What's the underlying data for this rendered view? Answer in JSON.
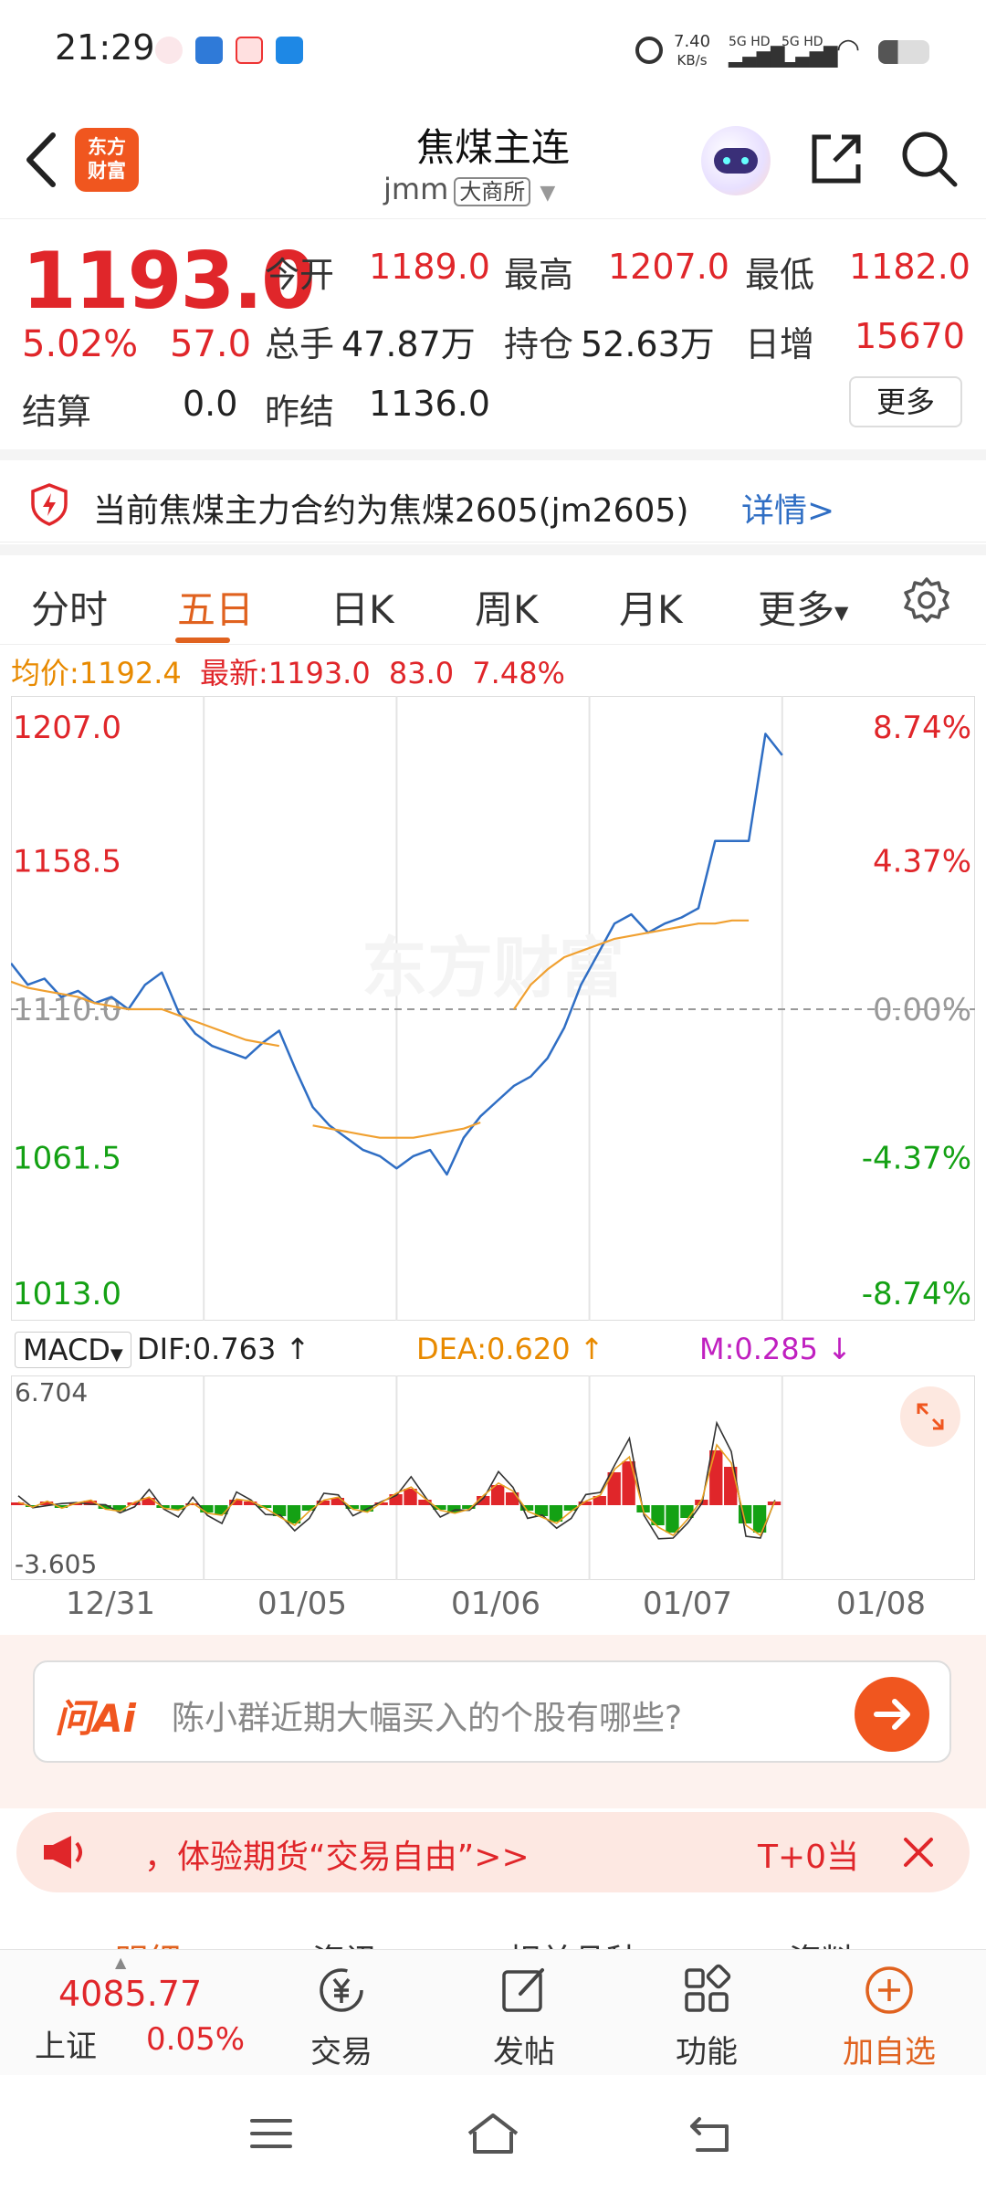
{
  "status_bar": {
    "time": "21:29",
    "net_speed_value": "7.40",
    "net_speed_unit": "KB/s",
    "sig1": "5G HD",
    "sig2": "5G HD"
  },
  "header": {
    "logo_text_line1": "东方",
    "logo_text_line2": "财富",
    "title": "焦煤主连",
    "code": "jmm",
    "exchange": "大商所"
  },
  "quote": {
    "price": "1193.0",
    "change_pct": "5.02%",
    "change_abs": "57.0",
    "open_label": "今开",
    "open": "1189.0",
    "high_label": "最高",
    "high": "1207.0",
    "low_label": "最低",
    "low": "1182.0",
    "volume_label": "总手",
    "volume": "47.87万",
    "oi_label": "持仓",
    "oi": "52.63万",
    "daily_inc_label": "日增",
    "daily_inc": "15670",
    "settle_label": "结算",
    "settle": "0.0",
    "prev_settle_label": "昨结",
    "prev_settle": "1136.0",
    "more": "更多"
  },
  "notice": {
    "text": "当前焦煤主力合约为焦煤2605(jm2605)",
    "detail": "详情>"
  },
  "tabs": [
    "分时",
    "五日",
    "日K",
    "周K",
    "月K",
    "更多"
  ],
  "active_tab": 1,
  "info_line": {
    "avg_label": "均价:",
    "avg": "1192.4",
    "latest_label": "最新:",
    "latest": "1193.0",
    "chg": "83.0",
    "pct": "7.48%"
  },
  "chart_data": {
    "type": "line",
    "title": "",
    "y_ticks_left": [
      "1207.0",
      "1158.5",
      "1110.0",
      "1061.5",
      "1013.0"
    ],
    "y_ticks_right": [
      "8.74%",
      "4.37%",
      "0.00%",
      "-4.37%",
      "-8.74%"
    ],
    "ylim": [
      1013.0,
      1207.0
    ],
    "x_labels": [
      "12/31",
      "01/05",
      "01/06",
      "01/07",
      "01/08"
    ],
    "series": [
      {
        "values": [
          1125,
          1118,
          1120,
          1114,
          1116,
          1112,
          1114,
          1110,
          1118,
          1122,
          1109,
          1102,
          1098,
          1096,
          1094,
          1099,
          1103,
          1090,
          1078,
          1072,
          1068,
          1064,
          1062,
          1058,
          1062,
          1064,
          1056,
          1068,
          1075,
          1080,
          1085,
          1088,
          1094,
          1104,
          1118,
          1128,
          1138,
          1141,
          1135,
          1138,
          1140,
          1143,
          1165,
          1165,
          1165,
          1200,
          1193
        ],
        "color": "#2f6ec4"
      },
      {
        "values": [
          1119,
          1117,
          1116,
          1115,
          1114,
          1112,
          1111,
          1110,
          1110,
          1110,
          1108,
          1106,
          1104,
          1102,
          1100,
          1099,
          1098,
          null,
          1072,
          1071,
          1070,
          1069,
          1068,
          1068,
          1068,
          1069,
          1070,
          1071,
          1073,
          null,
          1110,
          1118,
          1123,
          1127,
          1129,
          1131,
          1133,
          1134,
          1135,
          1136,
          1137,
          1138,
          1138,
          1139,
          1139,
          null,
          null
        ],
        "color": "#f0a030"
      }
    ]
  },
  "macd": {
    "selector": "MACD",
    "dif": "DIF:0.763",
    "dea": "DEA:0.620",
    "m": "M:0.285",
    "y_top": "6.704",
    "y_bottom": "-3.605"
  },
  "ai": {
    "logo": "问Ai",
    "placeholder": "陈小群近期大幅买入的个股有哪些?"
  },
  "promo": {
    "text": "，体验期货“交易自由”>>",
    "right": "T+0当"
  },
  "sub_tabs_peek": [
    "明细",
    "资讯",
    "相关品种",
    "资料"
  ],
  "bottom_nav": {
    "index_value": "4085.77",
    "index_name": "上证",
    "index_pct": "0.05%",
    "items": [
      "交易",
      "发帖",
      "功能",
      "加自选"
    ]
  },
  "colors": {
    "up": "#e0262a",
    "down": "#14a114",
    "accent": "#f0561f",
    "price_line": "#2f6ec4",
    "avg_line": "#f0a030"
  }
}
